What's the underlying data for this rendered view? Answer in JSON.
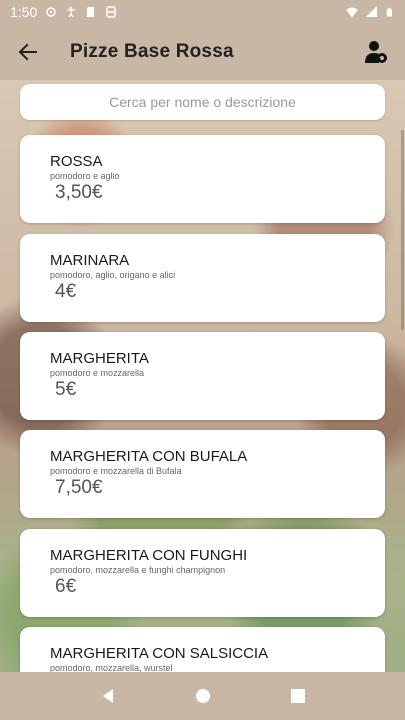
{
  "status_bar": {
    "time": "1:50",
    "icons": [
      "app-notification-icon",
      "accessibility-icon",
      "sd-card-icon",
      "storage-icon"
    ],
    "right_icons": [
      "wifi-icon",
      "signal-icon",
      "battery-icon"
    ]
  },
  "app_bar": {
    "title": "Pizze Base Rossa",
    "back_icon": "arrow-left-icon",
    "profile_icon": "user-settings-icon"
  },
  "search": {
    "placeholder": "Cerca per nome o descrizione",
    "value": ""
  },
  "items": [
    {
      "name": "ROSSA",
      "description": "pomodoro e aglio",
      "price": "3,50€"
    },
    {
      "name": "MARINARA",
      "description": "pomodoro, aglio, origano e alici",
      "price": "4€"
    },
    {
      "name": "MARGHERITA",
      "description": "pomodoro e mozzarella",
      "price": "5€"
    },
    {
      "name": "MARGHERITA CON BUFALA",
      "description": "pomodoro e mozzarella di Bufala",
      "price": "7,50€"
    },
    {
      "name": "MARGHERITA CON FUNGHI",
      "description": "pomodoro, mozzarella e funghi champignon",
      "price": "6€"
    },
    {
      "name": "MARGHERITA CON SALSICCIA",
      "description": "pomodoro, mozzarella, wurstel",
      "price": ""
    }
  ],
  "colors": {
    "bar_background": "#c8b7a4",
    "card_background": "#ffffff",
    "title_text": "#222222",
    "price_text": "#555555"
  }
}
